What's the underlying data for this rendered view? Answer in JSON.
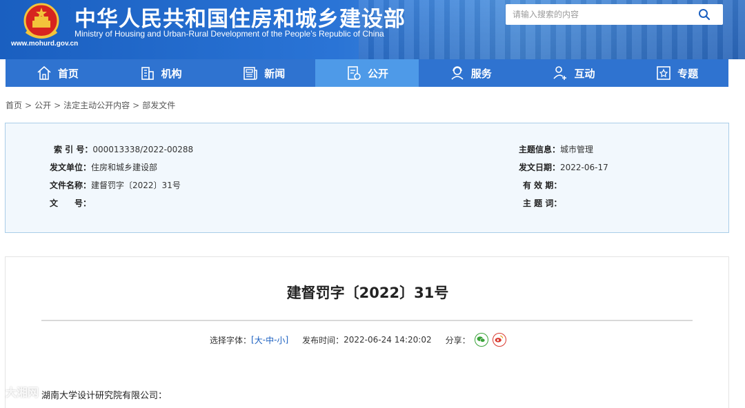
{
  "header": {
    "title": "中华人民共和国住房和城乡建设部",
    "subtitle": "Ministry of Housing and Urban-Rural Development of the People’s Republic of China",
    "domain": "www.mohurd.gov.cn",
    "search_placeholder": "请输入搜索的内容",
    "brand_color": "#2f73d0"
  },
  "nav": {
    "items": [
      {
        "label": "首页",
        "icon": "home-icon"
      },
      {
        "label": "机构",
        "icon": "building-icon"
      },
      {
        "label": "新闻",
        "icon": "newspaper-icon"
      },
      {
        "label": "公开",
        "icon": "document-icon",
        "active": true
      },
      {
        "label": "服务",
        "icon": "service-person-icon"
      },
      {
        "label": "互动",
        "icon": "interaction-icon"
      },
      {
        "label": "专题",
        "icon": "star-badge-icon"
      }
    ]
  },
  "breadcrumb": {
    "items": [
      "首页",
      "公开",
      "法定主动公开内容",
      "部发文件"
    ],
    "separator": ">"
  },
  "info": {
    "index_label": "索 引 号：",
    "index_value": "000013338/2022-00288",
    "issuer_label": "发文单位：",
    "issuer_value": "住房和城乡建设部",
    "docname_label": "文件名称：",
    "docname_value": "建督罚字〔2022〕31号",
    "docno_label": "文　　号：",
    "docno_value": "",
    "topic_label": "主题信息：",
    "topic_value": "城市管理",
    "date_label": "发文日期：",
    "date_value": "2022-06-17",
    "validity_label": "有 效 期：",
    "validity_value": "",
    "keywords_label": "主 题 词：",
    "keywords_value": ""
  },
  "article": {
    "title": "建督罚字〔2022〕31号",
    "font_label": "选择字体：",
    "bracket_open": "[",
    "font_large": "大",
    "font_dash1": " - ",
    "font_medium": "中",
    "font_dash2": " - ",
    "font_small": "小",
    "bracket_close": "]",
    "publish_label": "发布时间：",
    "publish_value": "2022-06-24 14:20:02",
    "share_label": "分享：",
    "share_wechat": "wechat-icon",
    "share_weibo": "weibo-icon",
    "body_first_line": "湖南大学设计研究院有限公司："
  },
  "watermark": "大湘网"
}
